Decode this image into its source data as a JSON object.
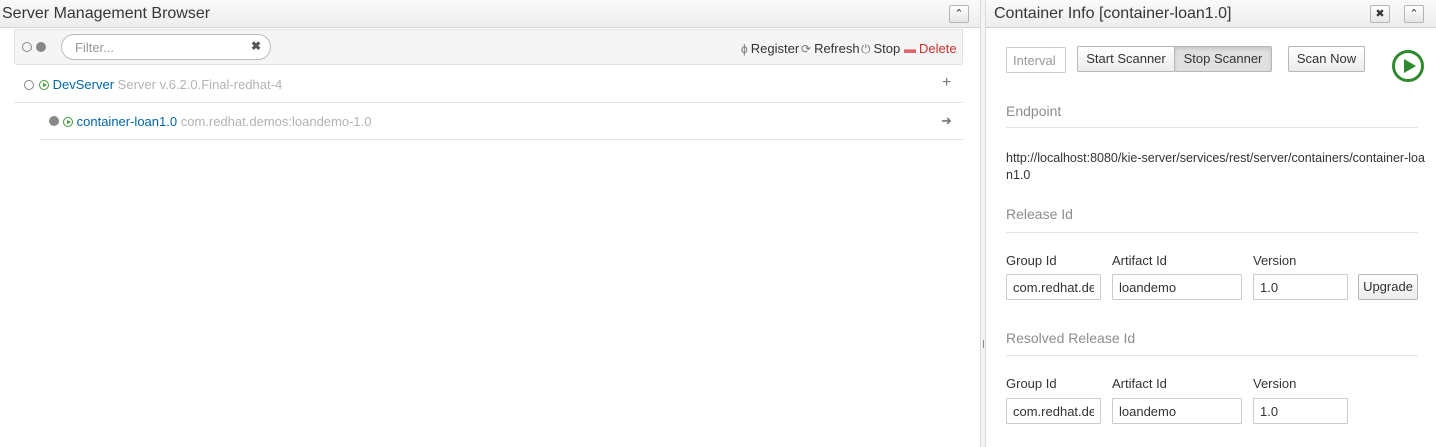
{
  "left_panel": {
    "title": "Server Management Browser",
    "collapse_icon": "chevron-up-icon",
    "filter": {
      "placeholder": "Filter...",
      "value": ""
    },
    "actions": {
      "register": "Register",
      "refresh": "Refresh",
      "stop": "Stop",
      "delete": "Delete"
    },
    "servers": [
      {
        "name": "DevServer",
        "description": "Server v.6.2.0.Final-redhat-4",
        "status": "started",
        "containers": [
          {
            "name": "container-loan1.0",
            "release": "com.redhat.demos:loandemo-1.0",
            "status": "started"
          }
        ]
      }
    ]
  },
  "right_panel": {
    "title": "Container Info [container-loan1.0]",
    "interval_placeholder": "Interval",
    "start_scanner": "Start Scanner",
    "stop_scanner": "Stop Scanner",
    "scan_now": "Scan Now",
    "endpoint_title": "Endpoint",
    "endpoint_url": "http://localhost:8080/kie-server/services/rest/server/containers/container-loan1.0",
    "release_title": "Release Id",
    "release": {
      "group_label": "Group Id",
      "group_value": "com.redhat.demos",
      "artifact_label": "Artifact Id",
      "artifact_value": "loandemo",
      "version_label": "Version",
      "version_value": "1.0",
      "upgrade": "Upgrade"
    },
    "resolved_title": "Resolved Release Id",
    "resolved": {
      "group_label": "Group Id",
      "group_value": "com.redhat.demos",
      "artifact_label": "Artifact Id",
      "artifact_value": "loandemo",
      "version_label": "Version",
      "version_value": "1.0"
    }
  },
  "colors": {
    "link": "#0066a8",
    "started": "#3f9c35",
    "delete": "#c9302c",
    "muted": "#b3b3b3"
  }
}
